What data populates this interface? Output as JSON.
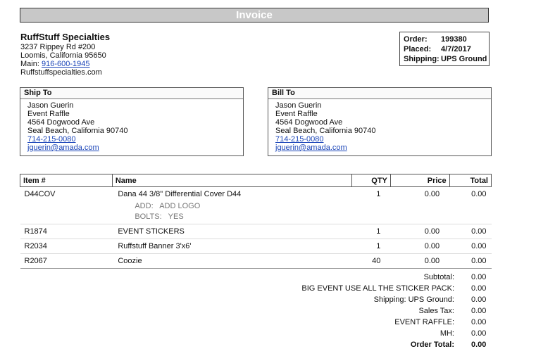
{
  "title": "Invoice",
  "company": {
    "name": "RuffStuff Specialties",
    "address1": "3237 Rippey Rd #200",
    "address2": "Loomis, California 95650",
    "main_label": "Main:",
    "main_phone": "916-600-1945",
    "website": "Ruffstuffspecialties.com"
  },
  "order": {
    "order_label": "Order:",
    "order_value": "199380",
    "placed_label": "Placed:",
    "placed_value": "4/7/2017",
    "shipping_label": "Shipping:",
    "shipping_value": "UPS Ground"
  },
  "ship_to": {
    "heading": "Ship To",
    "name": "Jason Guerin",
    "company": "Event Raffle",
    "street": "4564 Dogwood Ave",
    "city": "Seal Beach, California 90740",
    "phone": "714-215-0080",
    "email": "jguerin@amada.com"
  },
  "bill_to": {
    "heading": "Bill To",
    "name": "Jason Guerin",
    "company": "Event Raffle",
    "street": "4564 Dogwood Ave",
    "city": "Seal Beach, California 90740",
    "phone": "714-215-0080",
    "email": "jguerin@amada.com"
  },
  "table": {
    "headers": {
      "item": "Item #",
      "name": "Name",
      "qty": "QTY",
      "price": "Price",
      "total": "Total"
    },
    "rows": [
      {
        "item": "D44COV",
        "name": "Dana 44 3/8\" Differential Cover D44",
        "qty": "1",
        "price": "0.00",
        "total": "0.00",
        "options": [
          {
            "label": "ADD:",
            "value": "ADD LOGO"
          },
          {
            "label": "BOLTS:",
            "value": "YES"
          }
        ]
      },
      {
        "item": "R1874",
        "name": "EVENT STICKERS",
        "qty": "1",
        "price": "0.00",
        "total": "0.00"
      },
      {
        "item": "R2034",
        "name": "Ruffstuff Banner 3'x6'",
        "qty": "1",
        "price": "0.00",
        "total": "0.00"
      },
      {
        "item": "R2067",
        "name": "Coozie",
        "qty": "40",
        "price": "0.00",
        "total": "0.00"
      }
    ]
  },
  "totals": [
    {
      "label": "Subtotal:",
      "value": "0.00"
    },
    {
      "label": "BIG EVENT USE ALL THE STICKER PACK:",
      "value": "0.00"
    },
    {
      "label": "Shipping: UPS Ground:",
      "value": "0.00"
    },
    {
      "label": "Sales Tax:",
      "value": "0.00"
    },
    {
      "label": "EVENT RAFFLE:",
      "value": "0.00"
    },
    {
      "label": "MH:",
      "value": "0.00"
    },
    {
      "label": "Order Total:",
      "value": "0.00"
    }
  ]
}
